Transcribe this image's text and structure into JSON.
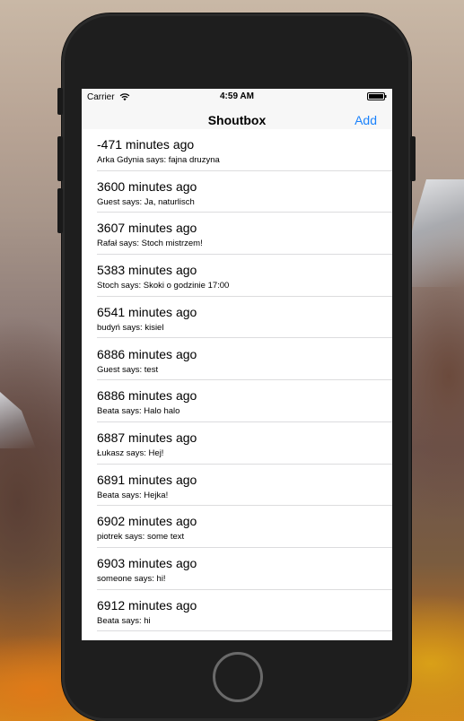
{
  "status_bar": {
    "carrier": "Carrier",
    "time": "4:59 AM",
    "wifi_icon": "wifi-icon",
    "battery_icon": "battery-icon"
  },
  "nav": {
    "title": "Shoutbox",
    "add_label": "Add",
    "accent_color": "#1a82fb"
  },
  "messages": [
    {
      "time": "-471 minutes ago",
      "text": "Arka Gdynia says: fajna druzyna"
    },
    {
      "time": "3600 minutes ago",
      "text": "Guest says: Ja, naturlisch"
    },
    {
      "time": "3607 minutes ago",
      "text": "Rafał says: Stoch mistrzem!"
    },
    {
      "time": "5383 minutes ago",
      "text": "Stoch says: Skoki o godzinie 17:00"
    },
    {
      "time": "6541 minutes ago",
      "text": "budyń says: kisiel"
    },
    {
      "time": "6886 minutes ago",
      "text": "Guest says: test"
    },
    {
      "time": "6886 minutes ago",
      "text": "Beata says: Halo halo"
    },
    {
      "time": "6887 minutes ago",
      "text": "Łukasz says: Hej!"
    },
    {
      "time": "6891 minutes ago",
      "text": "Beata says: Hejka!"
    },
    {
      "time": "6902 minutes ago",
      "text": "piotrek says: some text"
    },
    {
      "time": "6903 minutes ago",
      "text": "someone says: hi!"
    },
    {
      "time": "6912 minutes ago",
      "text": "Beata says: hi"
    }
  ]
}
